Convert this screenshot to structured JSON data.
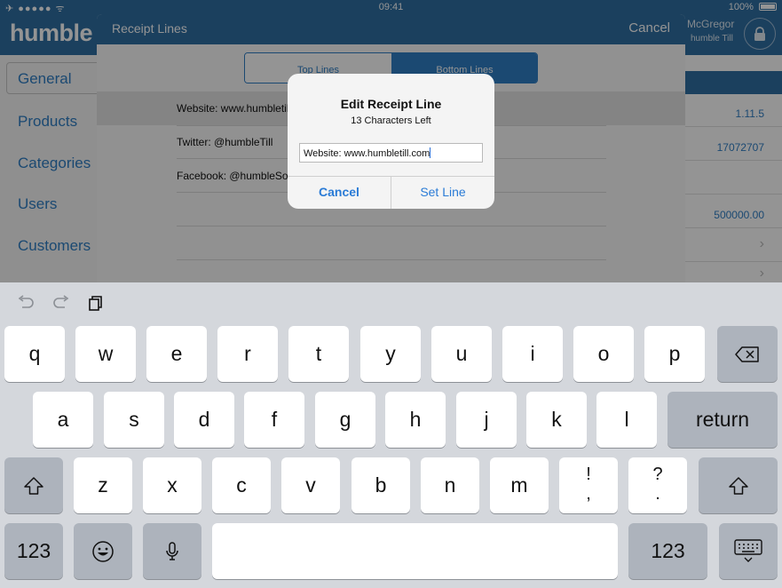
{
  "status_bar": {
    "left": "✈ ●●●●● ᯤ",
    "time": "09:41",
    "battery_pct": "100%"
  },
  "app": {
    "logo": "humble",
    "user_name": "McGregor",
    "user_sub": "humble Till",
    "sidebar": [
      "General",
      "Products",
      "Categories",
      "Users",
      "Customers"
    ],
    "right_values": [
      "1.11.5",
      "17072707",
      "500000.00"
    ]
  },
  "receipt_modal": {
    "title": "Receipt Lines",
    "cancel": "Cancel",
    "tab_top": "Top Lines",
    "tab_bottom": "Bottom Lines",
    "lines": [
      "Website: www.humbletill.com",
      "Twitter: @humbleTill",
      "Facebook: @humbleSoft"
    ]
  },
  "alert": {
    "title": "Edit Receipt Line",
    "message": "13 Characters Left",
    "input_value": "Website: www.humbletill.com",
    "cancel": "Cancel",
    "confirm": "Set Line"
  },
  "keyboard": {
    "row1": [
      "q",
      "w",
      "e",
      "r",
      "t",
      "y",
      "u",
      "i",
      "o",
      "p"
    ],
    "row2": [
      "a",
      "s",
      "d",
      "f",
      "g",
      "h",
      "j",
      "k",
      "l"
    ],
    "row3": [
      "z",
      "x",
      "c",
      "v",
      "b",
      "n",
      "m"
    ],
    "return": "return",
    "numbers": "123",
    "punct1": [
      "!",
      ","
    ],
    "punct2": [
      "?",
      "."
    ]
  }
}
